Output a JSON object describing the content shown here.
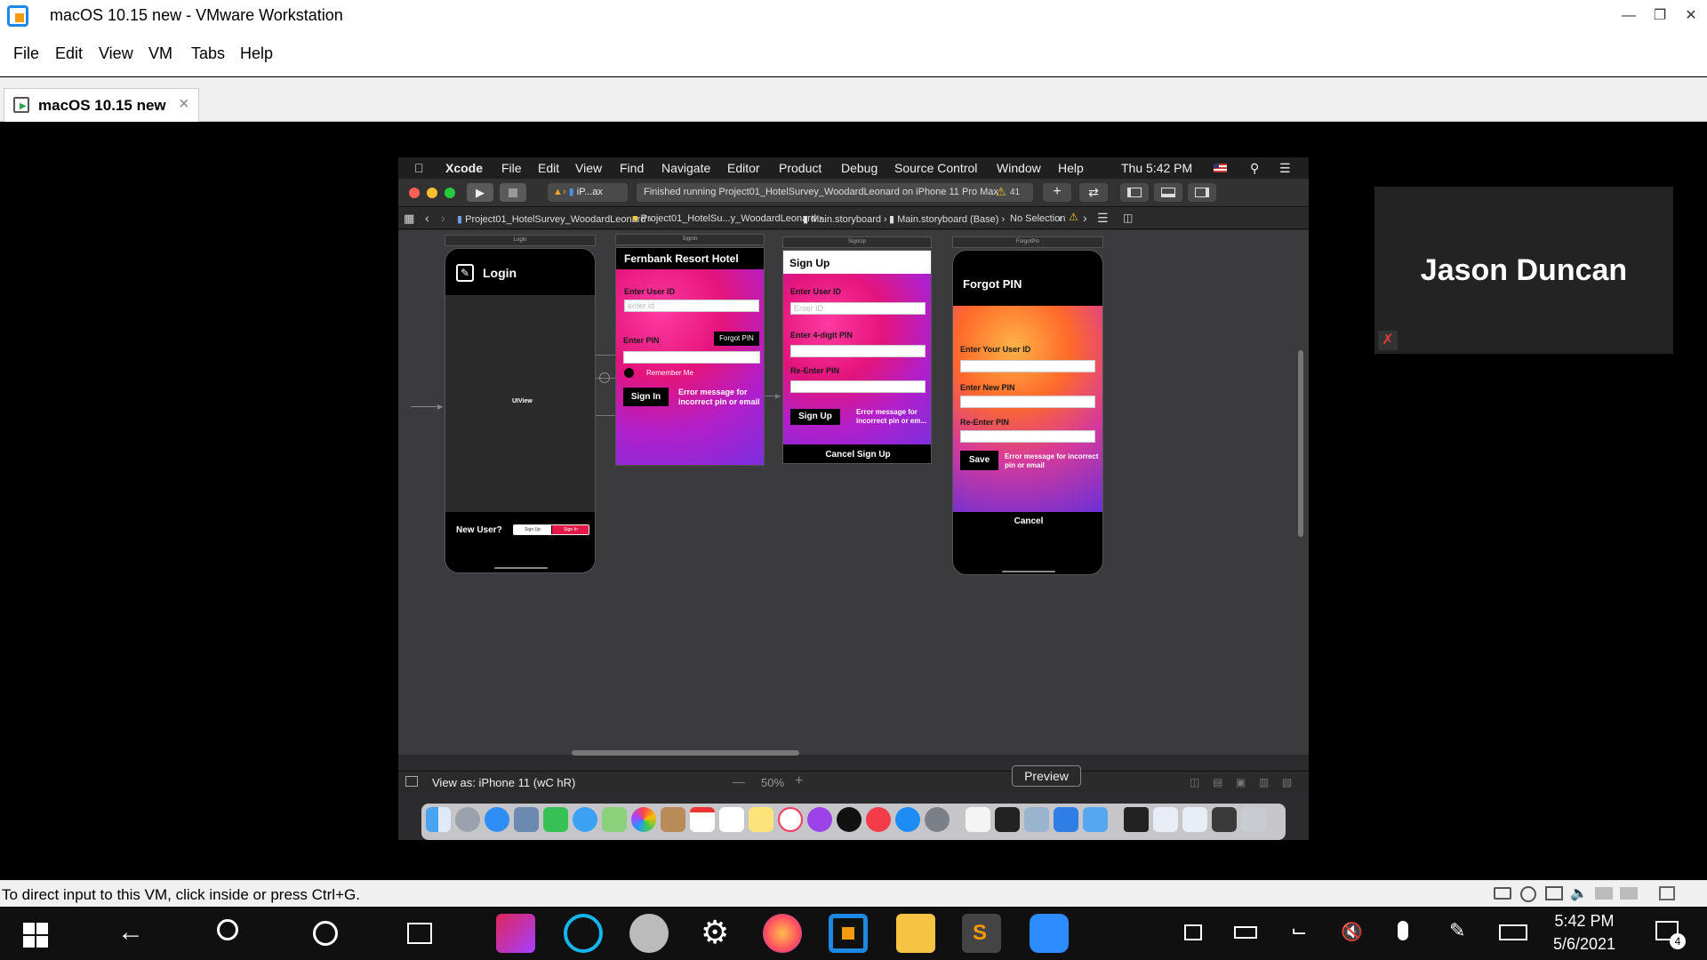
{
  "vmware": {
    "title": "macOS 10.15 new - VMware Workstation",
    "menu": [
      "File",
      "Edit",
      "View",
      "VM",
      "Tabs",
      "Help"
    ],
    "tab_label": "macOS 10.15 new",
    "status_text": "To direct input to this VM, click inside or press Ctrl+G."
  },
  "participant": {
    "name": "Jason Duncan"
  },
  "mac": {
    "menubar": {
      "app": "Xcode",
      "items": [
        "File",
        "Edit",
        "View",
        "Find",
        "Navigate",
        "Editor",
        "Product",
        "Debug",
        "Source Control",
        "Window",
        "Help"
      ],
      "clock": "Thu 5:42 PM"
    },
    "toolbar": {
      "scheme": "iP...ax",
      "activity": "Finished running Project01_HotelSurvey_WoodardLeonard on iPhone 11 Pro Max",
      "warning_count": "41"
    },
    "jumpbar": {
      "crumbs": [
        "Project01_HotelSurvey_WoodardLeonard",
        "Project01_HotelSu...y_WoodardLeonard",
        "Main.storyboard",
        "Main.storyboard (Base)",
        "No Selection"
      ]
    },
    "bottombar": {
      "view_as": "View as: iPhone 11 (wC hR)",
      "zoom": "50%",
      "tooltip": "Preview"
    }
  },
  "scenes": {
    "login": {
      "scene_label": "Login",
      "title": "Login",
      "center_label": "UIView",
      "new_user": "New User?",
      "seg": [
        "Sign Up",
        "Sign In"
      ]
    },
    "signin": {
      "scene_label": "SignIn",
      "title": "Fernbank Resort Hotel",
      "user_label": "Enter User ID",
      "user_placeholder": "enter id",
      "pin_label": "Enter PIN",
      "forgot_button": "Forgot PIN",
      "remember": "Remember Me",
      "signin_button": "Sign In",
      "error": "Error message for incorrect pin or email"
    },
    "signup": {
      "scene_label": "SignUp",
      "title": "Sign Up",
      "user_label": "Enter User ID",
      "user_placeholder": "Enter ID",
      "pin_label": "Enter 4-digit PIN",
      "reenter_label": "Re-Enter PIN",
      "signup_button": "Sign Up",
      "error": "Error message for incorrect pin or em...",
      "cancel": "Cancel Sign Up"
    },
    "forgot": {
      "scene_label": "ForgotPin",
      "title": "Forgot PIN",
      "user_label": "Enter Your User ID",
      "new_pin_label": "Enter New PIN",
      "reenter_label": "Re-Enter PIN",
      "save_button": "Save",
      "error": "Error message for incorrect pin or email",
      "cancel": "Cancel"
    }
  },
  "taskbar": {
    "time": "5:42 PM",
    "date": "5/6/2021",
    "notifications": "4"
  }
}
